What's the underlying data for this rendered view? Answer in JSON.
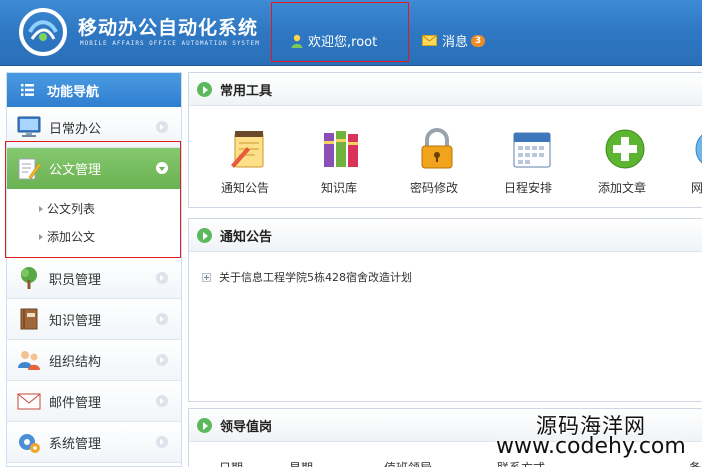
{
  "header": {
    "title": "移动办公自动化系统",
    "subtitle": "MOBILE AFFAIRS OFFICE AUTOMATION SYSTEM",
    "welcome": "欢迎您,root",
    "messages_label": "消息",
    "messages_count": "3"
  },
  "sidebar": {
    "title": "功能导航",
    "items": [
      {
        "label": "日常办公",
        "icon": "monitor-icon"
      },
      {
        "label": "公文管理",
        "icon": "document-edit-icon",
        "active": true,
        "children": [
          {
            "label": "公文列表"
          },
          {
            "label": "添加公文"
          }
        ]
      },
      {
        "label": "职员管理",
        "icon": "tree-icon"
      },
      {
        "label": "知识管理",
        "icon": "book-icon"
      },
      {
        "label": "组织结构",
        "icon": "users-icon"
      },
      {
        "label": "邮件管理",
        "icon": "mail-icon"
      },
      {
        "label": "系统管理",
        "icon": "gear-icon"
      }
    ]
  },
  "tools_panel": {
    "title": "常用工具",
    "tools": [
      {
        "label": "通知公告",
        "icon": "notepad-icon"
      },
      {
        "label": "知识库",
        "icon": "books-icon"
      },
      {
        "label": "密码修改",
        "icon": "lock-icon"
      },
      {
        "label": "日程安排",
        "icon": "calendar-icon"
      },
      {
        "label": "添加文章",
        "icon": "add-icon"
      },
      {
        "label": "网",
        "icon": "globe-icon"
      }
    ]
  },
  "notice_panel": {
    "title": "通知公告",
    "items": [
      {
        "label": "关于信息工程学院5栋428宿舍改造计划"
      }
    ]
  },
  "duty_panel": {
    "title": "领导值岗",
    "columns": [
      "日期",
      "星期",
      "值班领导",
      "联系方式",
      "备"
    ]
  },
  "watermark": {
    "line1": "源码海洋网",
    "line2": "www.codehy.com"
  },
  "colors": {
    "header_blue": "#2f78c4",
    "active_green": "#6ab253",
    "highlight_red": "#e21b1b",
    "badge_orange": "#f08a24"
  }
}
